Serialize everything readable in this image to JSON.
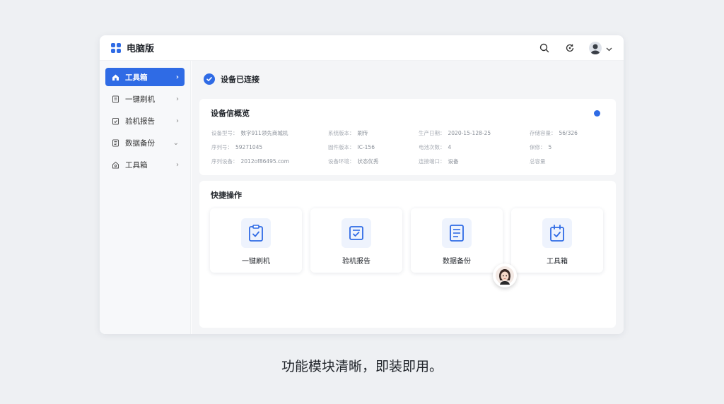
{
  "app": {
    "title": "电脑版"
  },
  "header": {
    "icons": [
      "search-icon",
      "refresh-icon",
      "user-avatar",
      "chevron-down-icon"
    ]
  },
  "sidebar": {
    "items": [
      {
        "label": "工具箱",
        "icon": "home-icon",
        "active": true
      },
      {
        "label": "一键刷机",
        "icon": "document-icon",
        "active": false
      },
      {
        "label": "验机报告",
        "icon": "report-icon",
        "active": false
      },
      {
        "label": "数据备份",
        "icon": "backup-icon",
        "active": false
      },
      {
        "label": "工具箱",
        "icon": "toolbox-icon",
        "active": false
      }
    ]
  },
  "status": {
    "text": "设备已连接"
  },
  "overview": {
    "title": "设备信概览",
    "fields": [
      {
        "key": "设备型号：",
        "value": "数字911领先商城机"
      },
      {
        "key": "系统版本：",
        "value": "刷传"
      },
      {
        "key": "生产日期：",
        "value": "2020-15-128-25"
      },
      {
        "key": "存储容量：",
        "value": "56/326"
      },
      {
        "key": "序列号：",
        "value": "59271045"
      },
      {
        "key": "固件版本：",
        "value": "IC-156"
      },
      {
        "key": "电池次数：",
        "value": "4"
      },
      {
        "key": "保修：",
        "value": "5"
      },
      {
        "key": "序列设备：",
        "value": "2012of86495.com"
      },
      {
        "key": "设备环境：",
        "value": "状态优秀"
      },
      {
        "key": "连接端口：",
        "value": "设备"
      },
      {
        "key": "总容量",
        "value": ""
      }
    ]
  },
  "quick": {
    "title": "快捷操作",
    "actions": [
      {
        "label": "一键刷机",
        "icon": "clipboard-check-icon"
      },
      {
        "label": "验机报告",
        "icon": "checklist-icon"
      },
      {
        "label": "数据备份",
        "icon": "document-lines-icon"
      },
      {
        "label": "工具箱",
        "icon": "calendar-check-icon"
      }
    ]
  },
  "caption": "功能模块清晰，即装即用。",
  "colors": {
    "accent": "#2f6be5",
    "background": "#eef0f3",
    "panel": "#f4f5f7"
  }
}
